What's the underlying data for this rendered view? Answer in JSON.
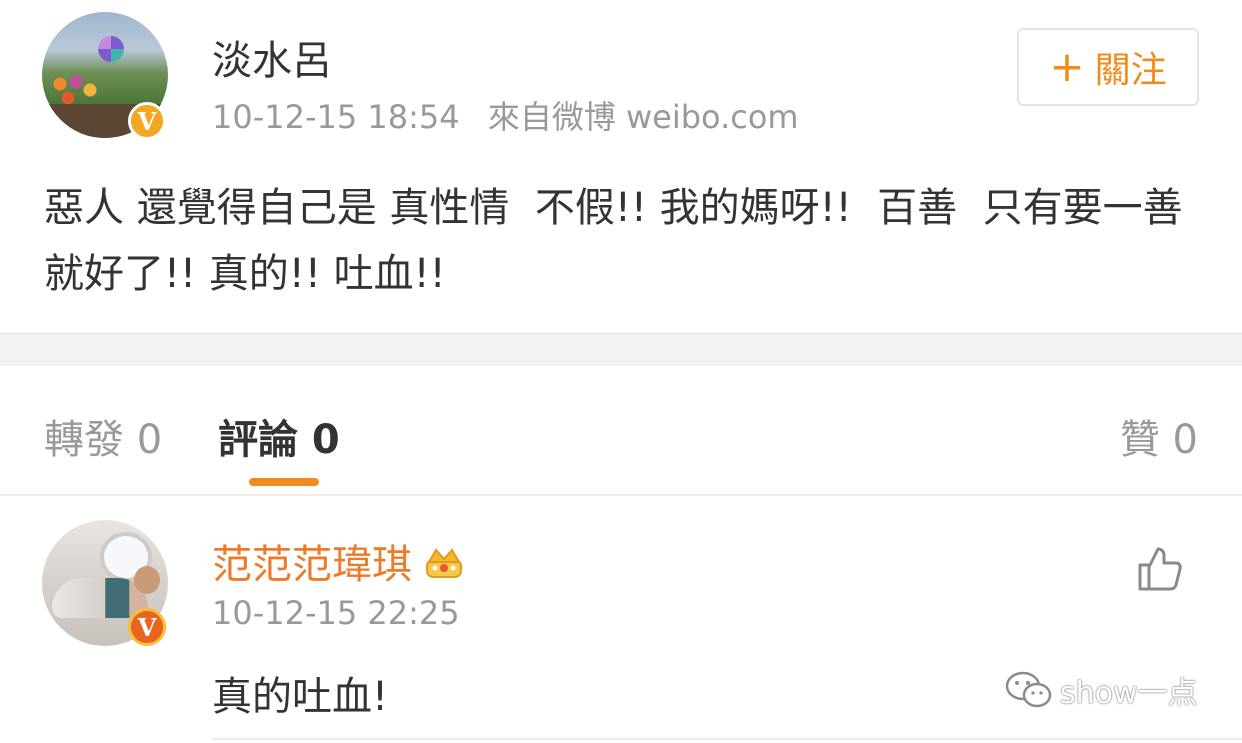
{
  "post": {
    "author": "淡水呂",
    "timestamp": "10-12-15 18:54",
    "source": "來自微博 weibo.com",
    "follow_plus": "+",
    "follow_label": "關注",
    "text": "惡人 還覺得自己是 真性情  不假!! 我的媽呀!!  百善  只有要一善就好了!! 真的!! 吐血!!",
    "avatar_badge": "V"
  },
  "tabs": {
    "repost": "轉發 0",
    "comments": "評論 0",
    "likes": "贊 0"
  },
  "comment": {
    "author": "范范范瑋琪",
    "timestamp": "10-12-15 22:25",
    "text": "真的吐血!",
    "avatar_badge": "V",
    "icons": [
      "crown-icon",
      "thumbs-up-icon"
    ]
  },
  "watermark": {
    "text": "show一点",
    "icon": "wechat-icon"
  },
  "colors": {
    "accent_orange": "#f28b1e",
    "comment_username": "#eb7b28",
    "badge_gold": "#f5a623",
    "badge_red": "#e86420",
    "text_primary": "#333333",
    "text_secondary": "#999999"
  }
}
